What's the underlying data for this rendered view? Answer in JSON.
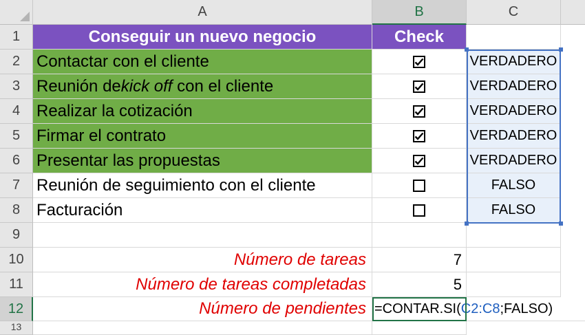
{
  "columns": [
    "A",
    "B",
    "C"
  ],
  "rows": [
    "1",
    "2",
    "3",
    "4",
    "5",
    "6",
    "7",
    "8",
    "9",
    "10",
    "11",
    "12",
    "13"
  ],
  "header": {
    "title": "Conseguir un nuevo negocio",
    "check": "Check"
  },
  "tasks": [
    {
      "pre": "Contactar con el cliente",
      "em": "",
      "post": "",
      "checked": true,
      "result": "VERDADERO"
    },
    {
      "pre": "Reunión de ",
      "em": "kick off",
      "post": " con el cliente",
      "checked": true,
      "result": "VERDADERO"
    },
    {
      "pre": "Realizar la cotización",
      "em": "",
      "post": "",
      "checked": true,
      "result": "VERDADERO"
    },
    {
      "pre": "Firmar el contrato",
      "em": "",
      "post": "",
      "checked": true,
      "result": "VERDADERO"
    },
    {
      "pre": "Presentar las propuestas",
      "em": "",
      "post": "",
      "checked": true,
      "result": "VERDADERO"
    },
    {
      "pre": "Reunión de seguimiento con el cliente",
      "em": "",
      "post": "",
      "checked": false,
      "result": "FALSO"
    },
    {
      "pre": "Facturación",
      "em": "",
      "post": "",
      "checked": false,
      "result": "FALSO"
    }
  ],
  "summary": {
    "total_label": "Número de tareas",
    "total_value": "7",
    "done_label": "Número de tareas completadas",
    "done_value": "5",
    "pending_label": "Número de pendientes",
    "formula_prefix": "=CONTAR.SI(",
    "formula_ref1": "C2",
    "formula_colon": ":",
    "formula_ref2": "C8",
    "formula_suffix": ";FALSO)"
  },
  "colors": {
    "green": "#70ad47",
    "purple": "#7b52c0",
    "label_red": "#e00000",
    "ref_blue": "#1f5fbf",
    "select_blue": "#4472c4"
  }
}
